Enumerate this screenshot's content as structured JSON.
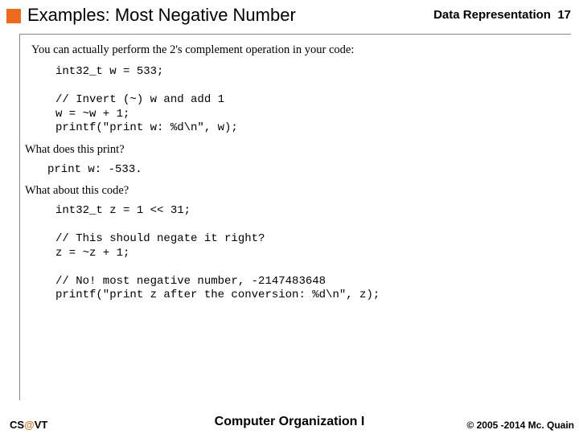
{
  "header": {
    "title": "Examples: Most Negative Number",
    "chapter_label": "Data Representation",
    "page_number": "17"
  },
  "body": {
    "intro": "You can actually perform the 2's complement operation in your code:",
    "code1_l1": "int32_t w = 533;",
    "code1_l2": "// Invert (~) w and add 1",
    "code1_l3": "w = ~w + 1;",
    "code1_l4": "printf(\"print w: %d\\n\", w);",
    "q1": "What does this print?",
    "output1": "print w: -533.",
    "q2": "What about this code?",
    "code2_l1": "int32_t z = 1 << 31;",
    "code2_l2": "// This should negate it right?",
    "code2_l3": "z = ~z + 1;",
    "code2_l4": "// No! most negative number, -2147483648",
    "code2_l5": "printf(\"print z after the conversion: %d\\n\", z);"
  },
  "footer": {
    "org_prefix": "CS",
    "org_at": "@",
    "org_suffix": "VT",
    "course": "Computer Organization I",
    "copyright": "© 2005 -2014 Mc. Quain"
  }
}
